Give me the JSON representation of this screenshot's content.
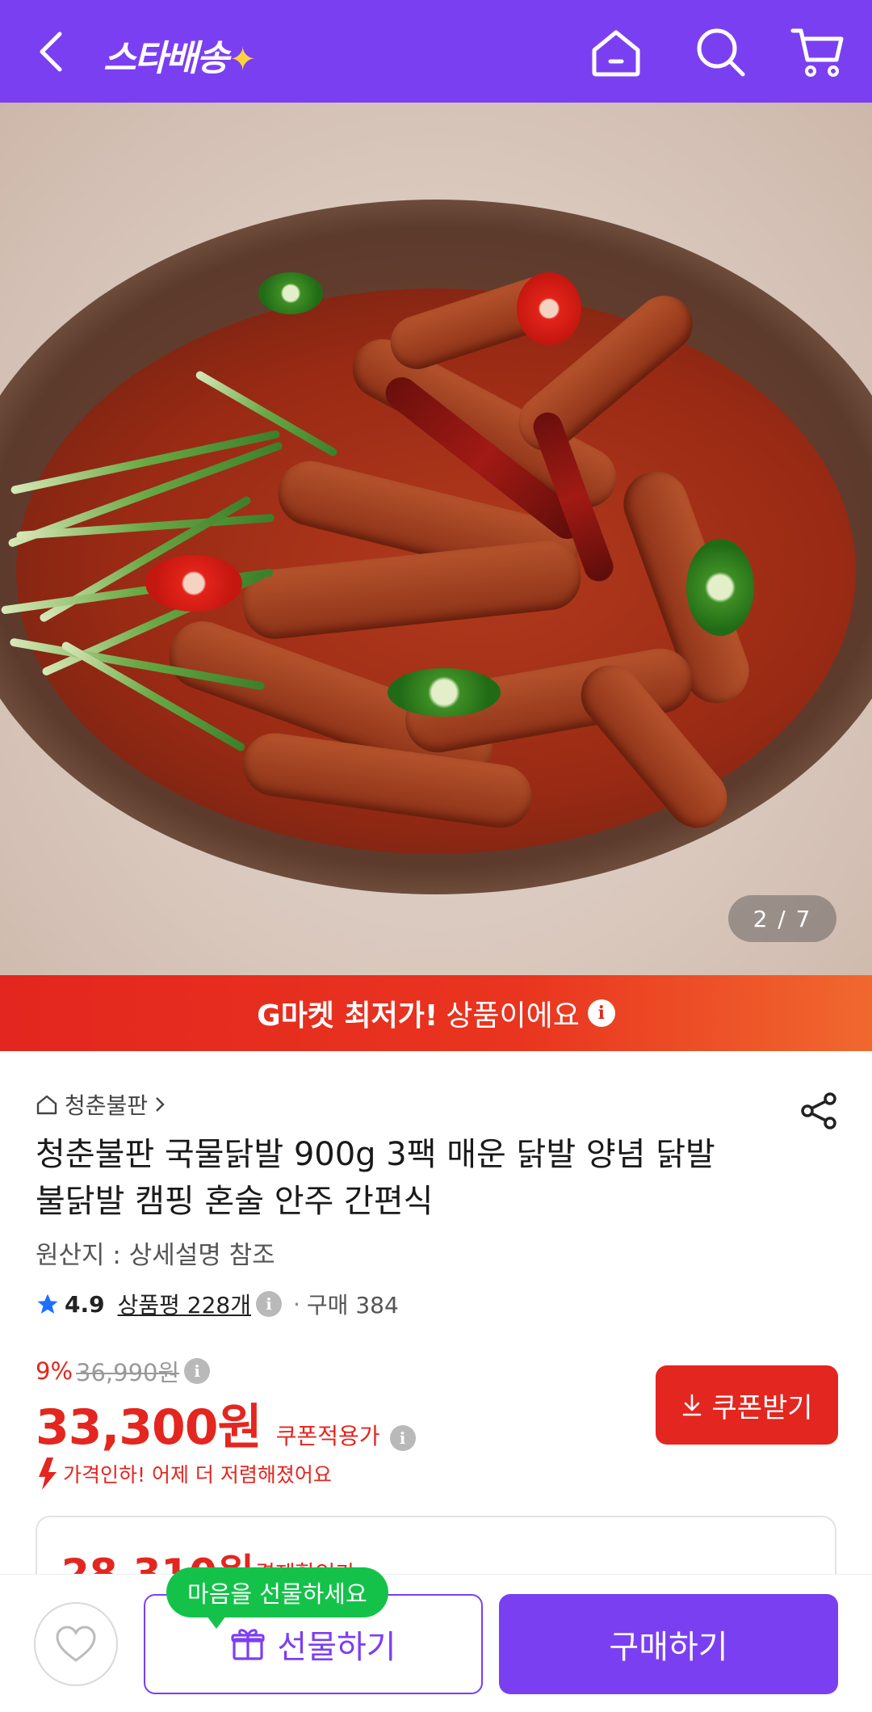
{
  "header": {
    "logo_text": "스타배송",
    "logo_star": "✦",
    "icons": [
      "back-arrow-icon",
      "home-icon",
      "search-icon",
      "cart-icon"
    ],
    "background_color": "#7b3ff2"
  },
  "gallery": {
    "counter": "2 / 7"
  },
  "promo": {
    "bold_text": "G마켓 최저가!",
    "text": "상품이에요",
    "info": "i"
  },
  "product": {
    "store": "청춘불판",
    "title": "청춘불판 국물닭발 900g 3팩 매운 닭발 양념 닭발 불닭발 캠핑 혼술 안주 간편식",
    "origin": "원산지 : 상세설명 참조",
    "rating": "4.9",
    "reviews": "상품평 228개",
    "purchases": "구매 384",
    "info": "i"
  },
  "pricing": {
    "discount_pct": "9%",
    "original_price": "36,990원",
    "price": "33,300원",
    "price_label": "쿠폰적용가",
    "coupon_button": "쿠폰받기",
    "price_drop_text": "가격인하! 어제 더 저렴해졌어요",
    "payment_price": "28,310원",
    "payment_label": "결제할인가",
    "accent_color": "#e3261f"
  },
  "bottom_bar": {
    "tooltip": "마음을 선물하세요",
    "gift_button": "선물하기",
    "buy_button": "구매하기"
  }
}
